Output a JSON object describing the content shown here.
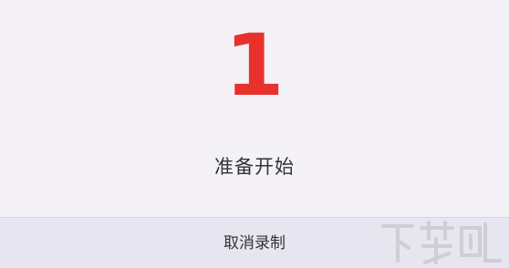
{
  "dialog": {
    "countdown_value": "1",
    "status_text": "准备开始",
    "cancel_label": "取消录制"
  },
  "colors": {
    "background": "#f4f2f6",
    "footer_background": "#e7e5ef",
    "countdown": "#e8312c",
    "text": "#333333"
  },
  "watermark": {
    "icon": "logo-watermark"
  }
}
